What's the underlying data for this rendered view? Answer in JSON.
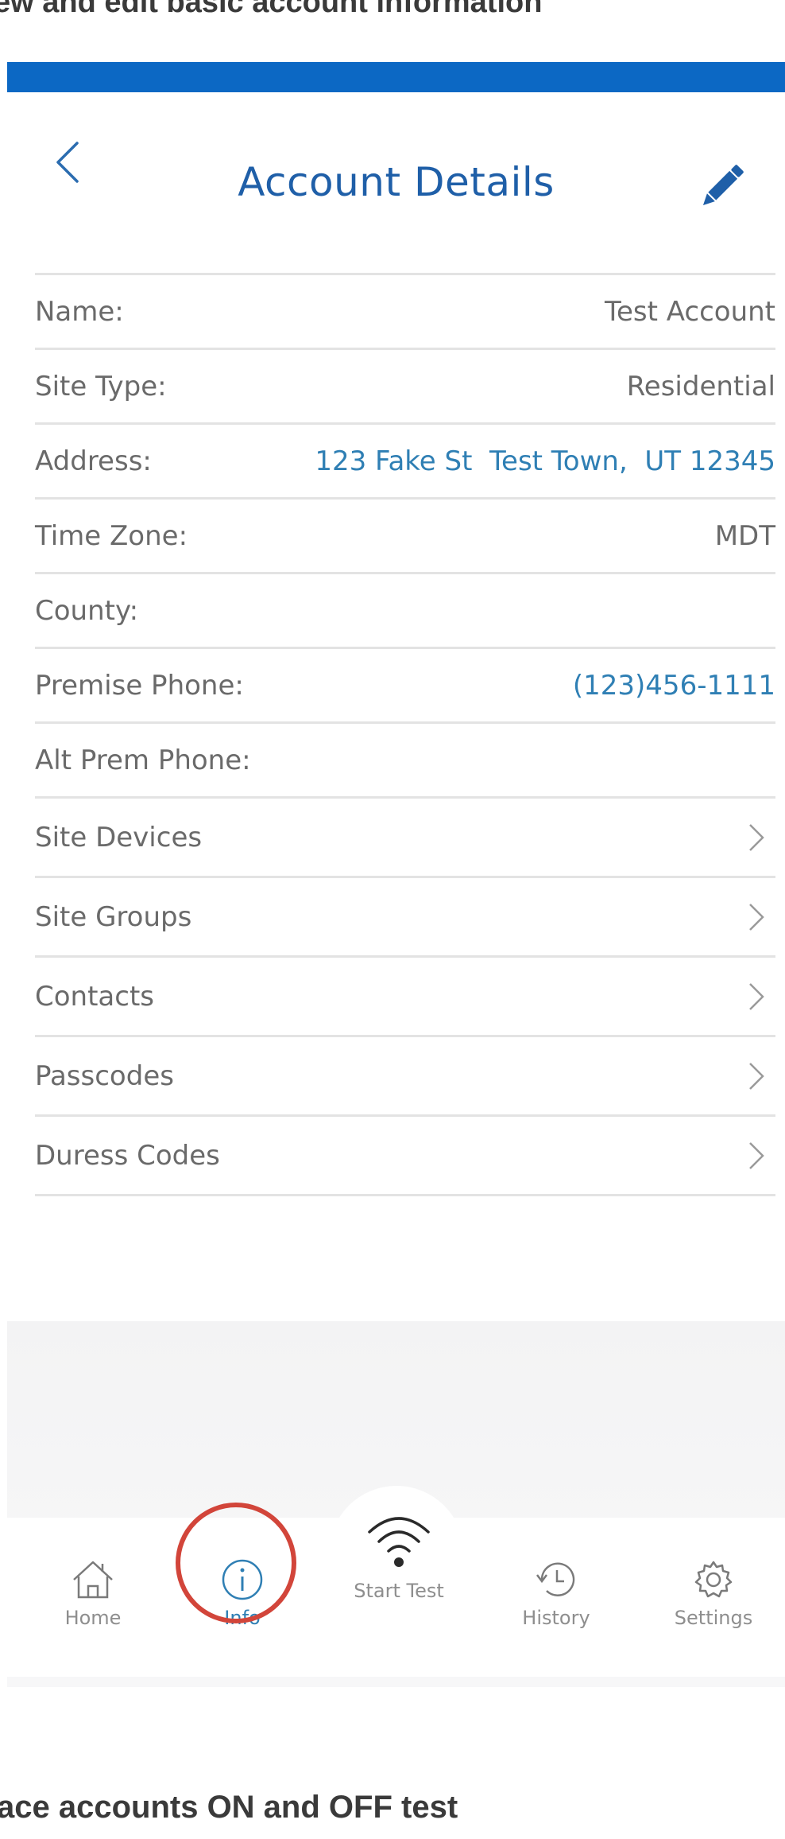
{
  "captions": {
    "top": "ew and edit basic account information",
    "bottom": "ace accounts ON and OFF test"
  },
  "header": {
    "title": "Account Details",
    "back_icon": "chevron-left-icon",
    "edit_icon": "pencil-icon"
  },
  "details": [
    {
      "label": "Name:",
      "value": "Test Account",
      "link": false
    },
    {
      "label": "Site Type:",
      "value": "Residential",
      "link": false
    },
    {
      "label": "Address:",
      "value": "123 Fake St  Test Town,  UT 12345",
      "link": true
    },
    {
      "label": "Time Zone:",
      "value": "MDT",
      "link": false
    },
    {
      "label": "County:",
      "value": "",
      "link": false
    },
    {
      "label": "Premise Phone:",
      "value": "(123)456-1111",
      "link": true
    },
    {
      "label": "Alt Prem Phone:",
      "value": "",
      "link": false
    }
  ],
  "nav_items": [
    {
      "label": "Site Devices"
    },
    {
      "label": "Site Groups"
    },
    {
      "label": "Contacts"
    },
    {
      "label": "Passcodes"
    },
    {
      "label": "Duress Codes"
    }
  ],
  "tabs": {
    "home": "Home",
    "info": "Info",
    "start_test": "Start Test",
    "history": "History",
    "settings": "Settings"
  },
  "colors": {
    "accent_blue": "#1f5fa8",
    "link_blue": "#2f7fb4",
    "status_bar": "#0c68c4",
    "highlight_red": "#d2453a"
  }
}
